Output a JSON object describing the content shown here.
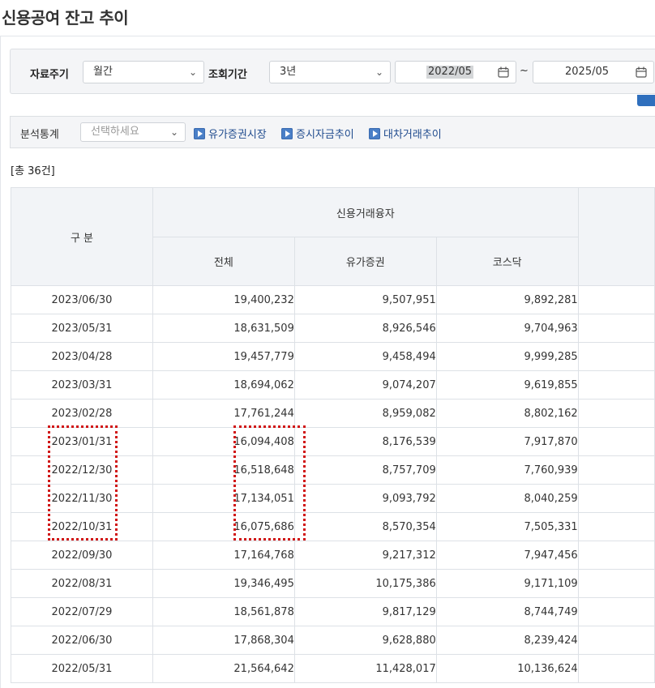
{
  "page": {
    "title": "신용공여 잔고 추이"
  },
  "search": {
    "period_label": "자료주기",
    "period_value": "월간",
    "range_label": "조회기간",
    "range_value": "3년",
    "start_date": "2022/05",
    "separator": "~",
    "end_date": "2025/05"
  },
  "stats": {
    "label": "분석통계",
    "select_placeholder": "선택하세요",
    "links": [
      "유가증권시장",
      "증시자금추이",
      "대차거래추이"
    ]
  },
  "total_count": "[총 36건]",
  "table": {
    "header_gubun": "구 분",
    "group_header": "신용거래융자",
    "columns": [
      "전체",
      "유가증권",
      "코스닥"
    ],
    "rows": [
      [
        "2023/06/30",
        "19,400,232",
        "9,507,951",
        "9,892,281"
      ],
      [
        "2023/05/31",
        "18,631,509",
        "8,926,546",
        "9,704,963"
      ],
      [
        "2023/04/28",
        "19,457,779",
        "9,458,494",
        "9,999,285"
      ],
      [
        "2023/03/31",
        "18,694,062",
        "9,074,207",
        "9,619,855"
      ],
      [
        "2023/02/28",
        "17,761,244",
        "8,959,082",
        "8,802,162"
      ],
      [
        "2023/01/31",
        "16,094,408",
        "8,176,539",
        "7,917,870"
      ],
      [
        "2022/12/30",
        "16,518,648",
        "8,757,709",
        "7,760,939"
      ],
      [
        "2022/11/30",
        "17,134,051",
        "9,093,792",
        "8,040,259"
      ],
      [
        "2022/10/31",
        "16,075,686",
        "8,570,354",
        "7,505,331"
      ],
      [
        "2022/09/30",
        "17,164,768",
        "9,217,312",
        "7,947,456"
      ],
      [
        "2022/08/31",
        "19,346,495",
        "10,175,386",
        "9,171,109"
      ],
      [
        "2022/07/29",
        "18,561,878",
        "9,817,129",
        "8,744,749"
      ],
      [
        "2022/06/30",
        "17,868,304",
        "9,628,880",
        "8,239,424"
      ],
      [
        "2022/05/31",
        "21,564,642",
        "11,428,017",
        "10,136,624"
      ]
    ]
  },
  "colors": {
    "accent": "#2f6fbd",
    "highlight": "#d01515",
    "header_bg": "#f2f4f7"
  },
  "icons": {
    "calendar": "calendar-icon",
    "chevron": "chevron-down-icon",
    "link": "play-icon"
  }
}
